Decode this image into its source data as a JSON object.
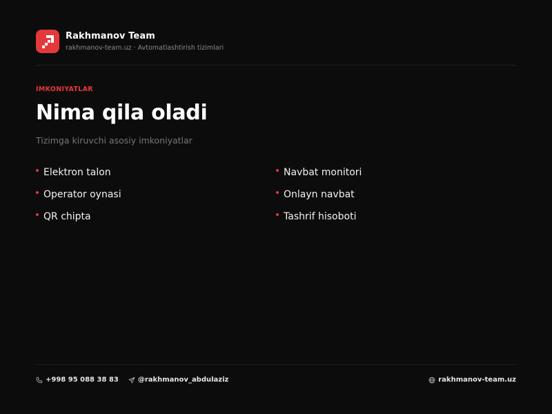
{
  "header": {
    "brand_name": "Rakhmanov Team",
    "brand_sub": "rakhmanov-team.uz · Avtomatlashtirish tizimlari",
    "logo_icon": "pixel-arrow-logo-icon"
  },
  "section": {
    "eyebrow": "IMKONIYATLAR",
    "title": "Nima qila oladi",
    "subtitle": "Tizimga kiruvchi asosiy imkoniyatlar"
  },
  "features": [
    "Elektron talon",
    "Navbat monitori",
    "Operator oynasi",
    "Onlayn navbat",
    "QR chipta",
    "Tashrif hisoboti"
  ],
  "footer": {
    "phone": "+998 95 088 38 83",
    "telegram": "@rakhmanov_abdulaziz",
    "website": "rakhmanov-team.uz"
  },
  "colors": {
    "background": "#0c0c0d",
    "accent": "#e5383b",
    "text": "#ffffff",
    "muted": "#76767b"
  }
}
